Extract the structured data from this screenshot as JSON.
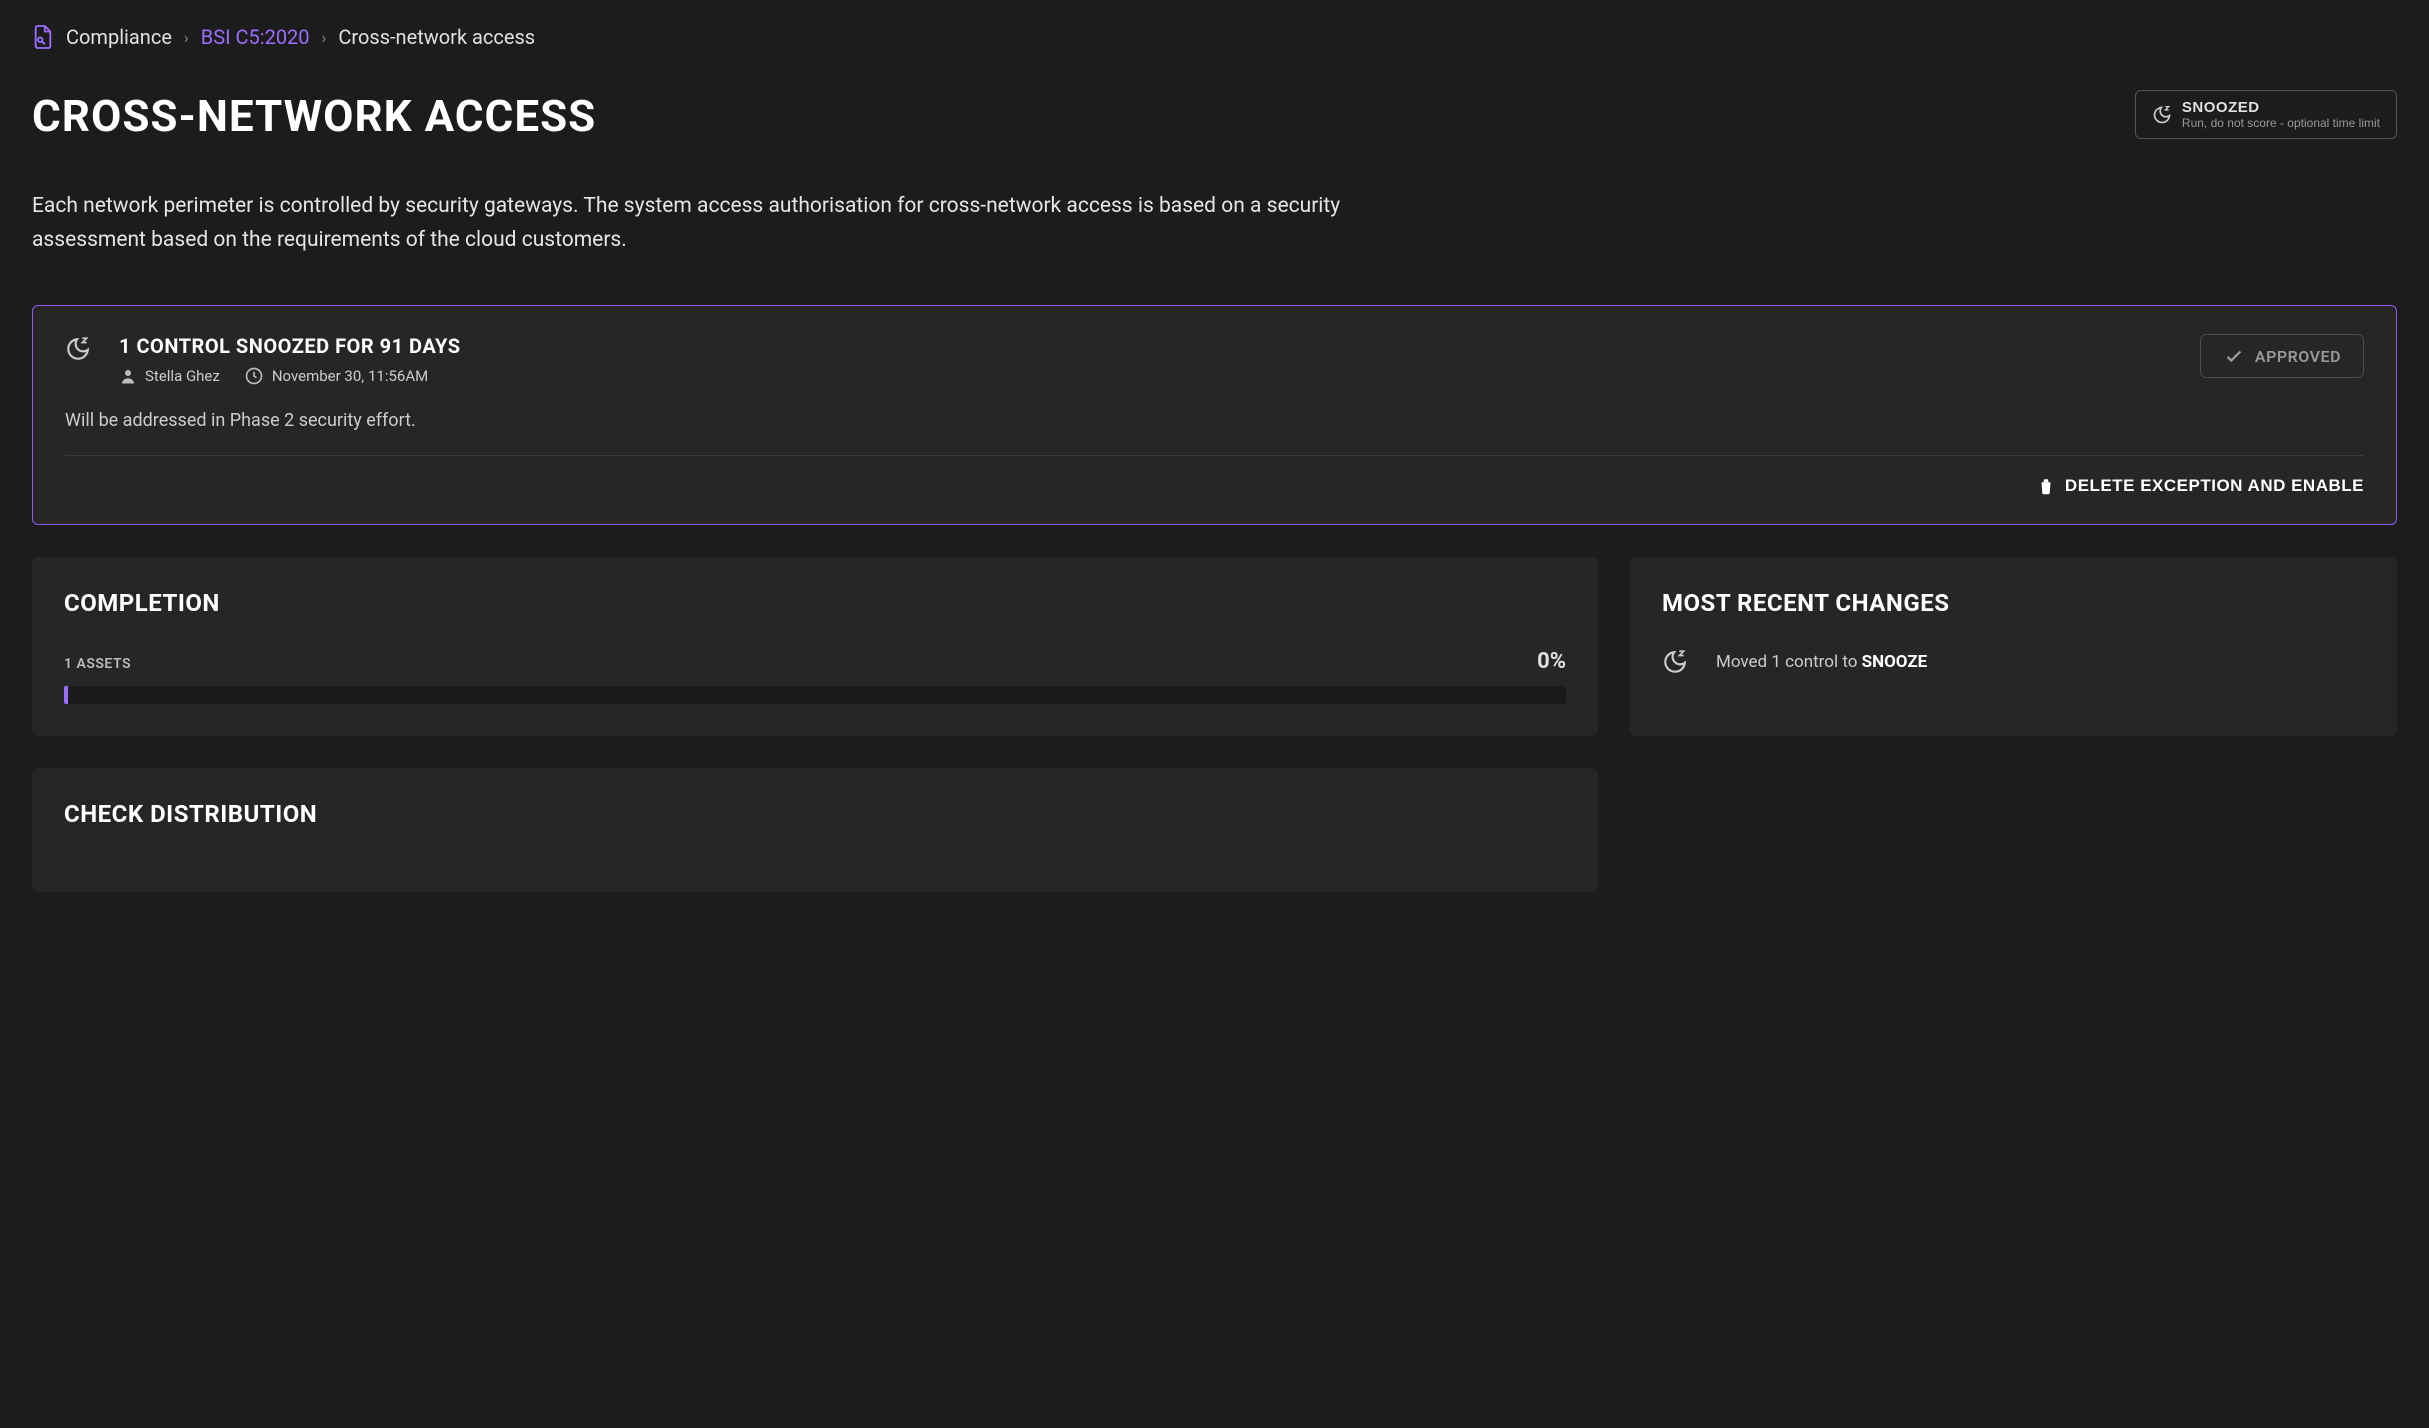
{
  "breadcrumb": {
    "root": "Compliance",
    "framework": "BSI C5:2020",
    "current": "Cross-network access"
  },
  "page": {
    "title": "CROSS-NETWORK ACCESS",
    "description": "Each network perimeter is controlled by security gateways. The system access authorisation for cross-network access is based on a security assessment based on the requirements of the cloud customers."
  },
  "status": {
    "label": "SNOOZED",
    "sub": "Run, do not score - optional time limit"
  },
  "exception": {
    "title": "1 CONTROL SNOOZED FOR 91 DAYS",
    "author": "Stella Ghez",
    "timestamp": "November 30, 11:56AM",
    "note": "Will be addressed in Phase 2 security effort.",
    "approved_label": "APPROVED",
    "delete_label": "DELETE EXCEPTION AND ENABLE"
  },
  "completion": {
    "title": "COMPLETION",
    "assets": "1 ASSETS",
    "percent": "0%"
  },
  "recent": {
    "title": "MOST RECENT CHANGES",
    "change_prefix": "Moved 1 control to ",
    "change_state": "SNOOZE"
  },
  "check_dist": {
    "title": "CHECK DISTRIBUTION"
  }
}
